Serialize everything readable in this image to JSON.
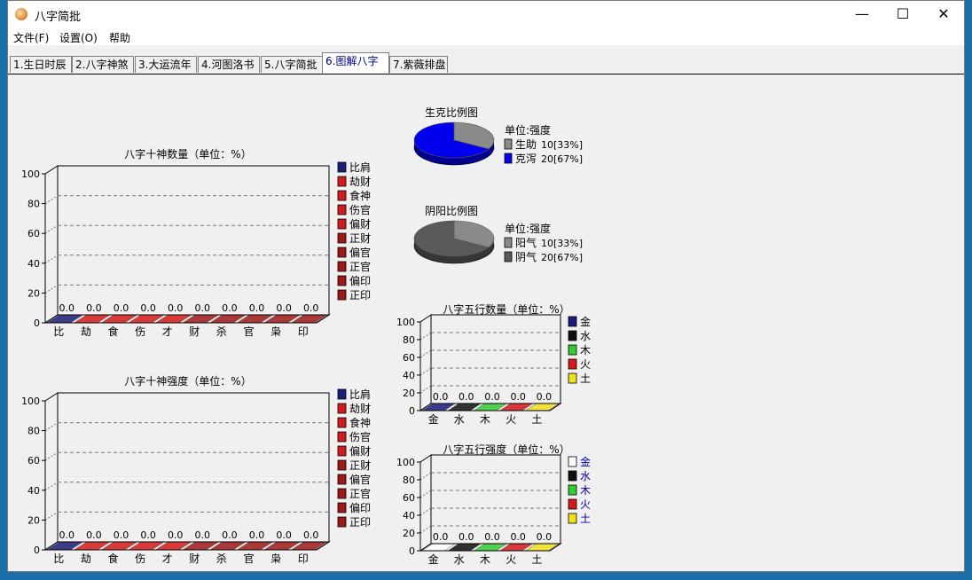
{
  "window": {
    "title": "八字简批",
    "minimize_label": "—",
    "maximize_label": "☐",
    "close_label": "✕"
  },
  "menu": [
    "文件(F)",
    "设置(O)",
    "帮助"
  ],
  "tabs": [
    "1.生日时辰",
    "2.八字神煞",
    "3.大运流年",
    "4.河图洛书",
    "5.八字简批",
    "6.图解八字",
    "7.紫薇排盘"
  ],
  "active_tab": 5,
  "colors": {
    "navy": "#1c1c7a",
    "red": "#d41a1a",
    "darkred": "#a01818",
    "black": "#111111",
    "green": "#33cc33",
    "yellow": "#f0e020",
    "white": "#ffffff",
    "blue": "#0000ee",
    "gray": "#8a8a8a",
    "dimgray": "#5a5a5a"
  },
  "charts": {
    "shishen_count": {
      "title": "八字十神数量（单位：%）",
      "ylim": [
        0,
        100
      ],
      "yticks": [
        "100",
        "80",
        "60",
        "40",
        "20",
        "0"
      ],
      "categories": [
        "比",
        "劫",
        "食",
        "伤",
        "才",
        "财",
        "杀",
        "官",
        "枭",
        "印"
      ],
      "values": [
        0,
        0,
        0,
        0,
        0,
        0,
        0,
        0,
        0,
        0
      ],
      "value_labels": [
        "0.0",
        "0.0",
        "0.0",
        "0.0",
        "0.0",
        "0.0",
        "0.0",
        "0.0",
        "0.0",
        "0.0"
      ],
      "legend": [
        "比肩",
        "劫财",
        "食神",
        "伤官",
        "偏财",
        "正财",
        "偏官",
        "正官",
        "偏印",
        "正印"
      ],
      "legend_colors": [
        "navy",
        "red",
        "red",
        "red",
        "red",
        "darkred",
        "darkred",
        "darkred",
        "darkred",
        "darkred"
      ]
    },
    "shishen_strength": {
      "title": "八字十神强度（单位：%）",
      "ylim": [
        0,
        100
      ],
      "yticks": [
        "100",
        "80",
        "60",
        "40",
        "20",
        "0"
      ],
      "categories": [
        "比",
        "劫",
        "食",
        "伤",
        "才",
        "财",
        "杀",
        "官",
        "枭",
        "印"
      ],
      "values": [
        0,
        0,
        0,
        0,
        0,
        0,
        0,
        0,
        0,
        0
      ],
      "value_labels": [
        "0.0",
        "0.0",
        "0.0",
        "0.0",
        "0.0",
        "0.0",
        "0.0",
        "0.0",
        "0.0",
        "0.0"
      ],
      "legend": [
        "比肩",
        "劫财",
        "食神",
        "伤官",
        "偏财",
        "正财",
        "偏官",
        "正官",
        "偏印",
        "正印"
      ],
      "legend_colors": [
        "navy",
        "red",
        "red",
        "red",
        "red",
        "darkred",
        "darkred",
        "darkred",
        "darkred",
        "darkred"
      ]
    },
    "wuxing_count": {
      "title": "八字五行数量（单位：%）",
      "ylim": [
        0,
        100
      ],
      "yticks": [
        "100",
        "80",
        "60",
        "40",
        "20",
        "0"
      ],
      "categories": [
        "金",
        "水",
        "木",
        "火",
        "土"
      ],
      "values": [
        0,
        0,
        0,
        0,
        0
      ],
      "value_labels": [
        "0.0",
        "0.0",
        "0.0",
        "0.0",
        "0.0"
      ],
      "legend": [
        "金",
        "水",
        "木",
        "火",
        "土"
      ],
      "legend_colors": [
        "navy",
        "black",
        "green",
        "red",
        "yellow"
      ],
      "legend_text_blue": false
    },
    "wuxing_strength": {
      "title": "八字五行强度（单位：%）",
      "ylim": [
        0,
        100
      ],
      "yticks": [
        "100",
        "80",
        "60",
        "40",
        "20",
        "0"
      ],
      "categories": [
        "金",
        "水",
        "木",
        "火",
        "土"
      ],
      "values": [
        0,
        0,
        0,
        0,
        0
      ],
      "value_labels": [
        "0.0",
        "0.0",
        "0.0",
        "0.0",
        "0.0"
      ],
      "legend": [
        "金",
        "水",
        "木",
        "火",
        "土"
      ],
      "legend_colors": [
        "white",
        "black",
        "green",
        "red",
        "yellow"
      ],
      "legend_text_blue": true
    },
    "shengke_pie": {
      "title": "生克比例图",
      "unit": "单位:强度",
      "slices": [
        {
          "label": "生助",
          "value": 10,
          "pct": "10[33%]",
          "color": "gray"
        },
        {
          "label": "克泻",
          "value": 20,
          "pct": "20[67%]",
          "color": "blue"
        }
      ]
    },
    "yinyang_pie": {
      "title": "阴阳比例图",
      "unit": "单位:强度",
      "slices": [
        {
          "label": "阳气",
          "value": 10,
          "pct": "10[33%]",
          "color": "gray"
        },
        {
          "label": "阴气",
          "value": 20,
          "pct": "20[67%]",
          "color": "dimgray"
        }
      ]
    }
  }
}
